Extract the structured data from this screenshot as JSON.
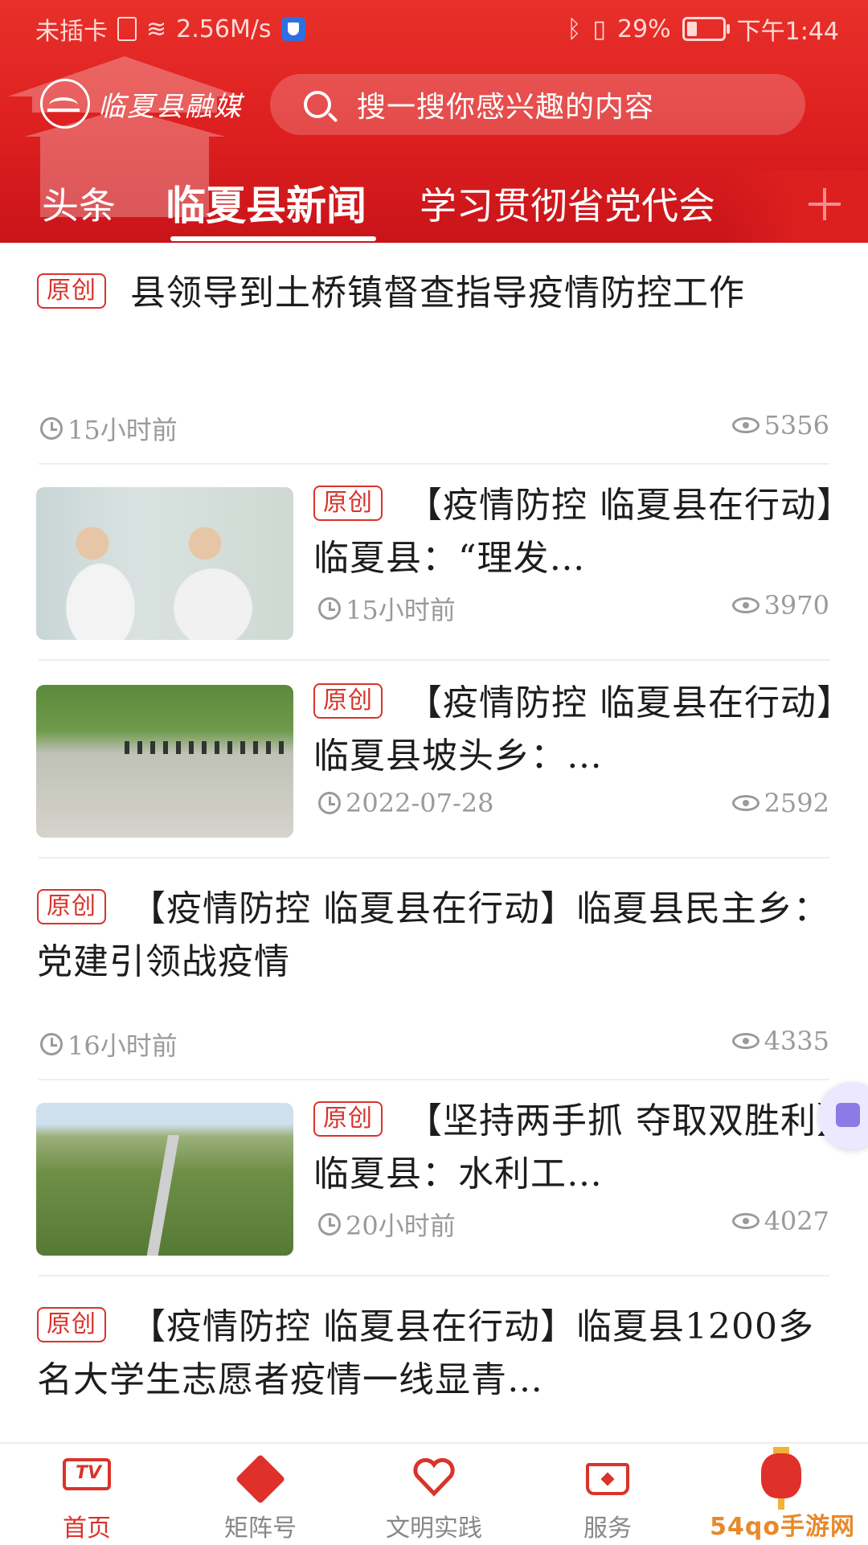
{
  "status_bar": {
    "carrier": "未插卡",
    "speed": "2.56M/s",
    "battery": "29%",
    "battery_level": 0.29,
    "time": "下午1:44"
  },
  "header": {
    "logo_text": "临夏县融媒",
    "search_placeholder": "搜一搜你感兴趣的内容",
    "tabs": [
      "头条",
      "临夏县新闻",
      "学习贯彻省党代会"
    ],
    "active_tab": 1
  },
  "feed": {
    "items": [
      {
        "tag": "原创",
        "title": "县领导到土桥镇督查指导疫情防控工作",
        "time": "15小时前",
        "views": "5356"
      },
      {
        "tag": "原创",
        "title": "【疫情防控  临夏县在行动】临夏县：“理发…",
        "time": "15小时前",
        "views": "3970"
      },
      {
        "tag": "原创",
        "title": "【疫情防控  临夏县在行动】临夏县坡头乡：…",
        "time": "2022-07-28",
        "views": "2592"
      },
      {
        "tag": "原创",
        "title": "【疫情防控  临夏县在行动】临夏县民主乡：党建引领战疫情",
        "time": "16小时前",
        "views": "4335"
      },
      {
        "tag": "原创",
        "title": "【坚持两手抓  夺取双胜利】临夏县：水利工…",
        "time": "20小时前",
        "views": "4027"
      },
      {
        "tag": "原创",
        "title": "【疫情防控  临夏县在行动】临夏县1200多名大学生志愿者疫情一线显青…",
        "time": "",
        "views": ""
      }
    ]
  },
  "bottom_nav": {
    "items": [
      "首页",
      "矩阵号",
      "文明实践",
      "服务",
      ""
    ],
    "active": 0
  },
  "watermark": "54qo手游网",
  "colors": {
    "brand_red": "#dd1f1f",
    "tag_red": "#d9332b",
    "meta_gray": "#9a9a9a"
  }
}
